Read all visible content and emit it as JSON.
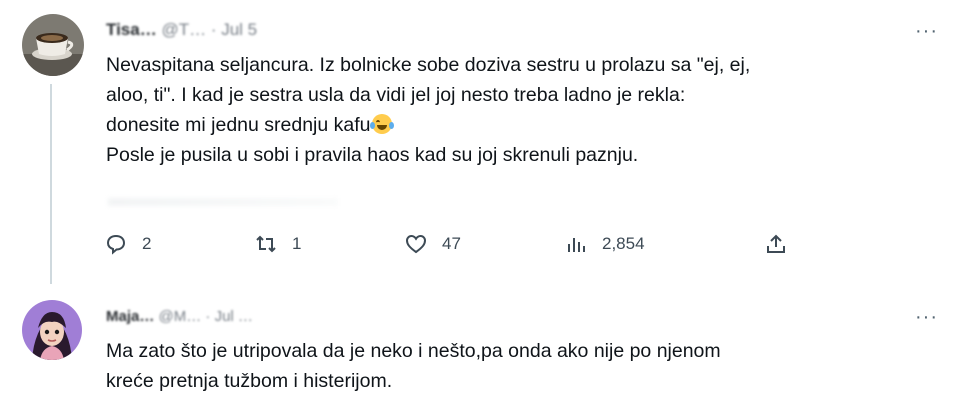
{
  "tweet": {
    "author_name": "Tisa…",
    "author_meta": "@T… · Jul 5",
    "text_lines": [
      "Nevaspitana seljancura. Iz bolnicke sobe doziva sestru u prolazu sa \"ej, ej,",
      "aloo, ti\". I kad je sestra usla da vidi jel joj nesto treba ladno je rekla:",
      "donesite mi jednu srednju kafu",
      "Posle je pusila u sobi i pravila haos kad su joj skrenuli paznju."
    ],
    "emoji": "face-with-tears-of-joy",
    "more_label": "···",
    "actions": {
      "replies": "2",
      "reposts": "1",
      "likes": "47",
      "views": "2,854"
    }
  },
  "reply": {
    "author_name": "Maja…",
    "author_meta": "@M… · Jul …",
    "text_lines": [
      "Ma zato što je utripovala da je neko i nešto,pa onda ako nije po njenom",
      "kreće pretnja tužbom i histerijom."
    ],
    "more_label": "···"
  },
  "colors": {
    "text": "#0f1419",
    "muted": "#536471",
    "thread_line": "#cfd9de"
  },
  "icons": [
    "reply-icon",
    "repost-icon",
    "like-icon",
    "views-icon",
    "share-icon",
    "more-icon"
  ]
}
